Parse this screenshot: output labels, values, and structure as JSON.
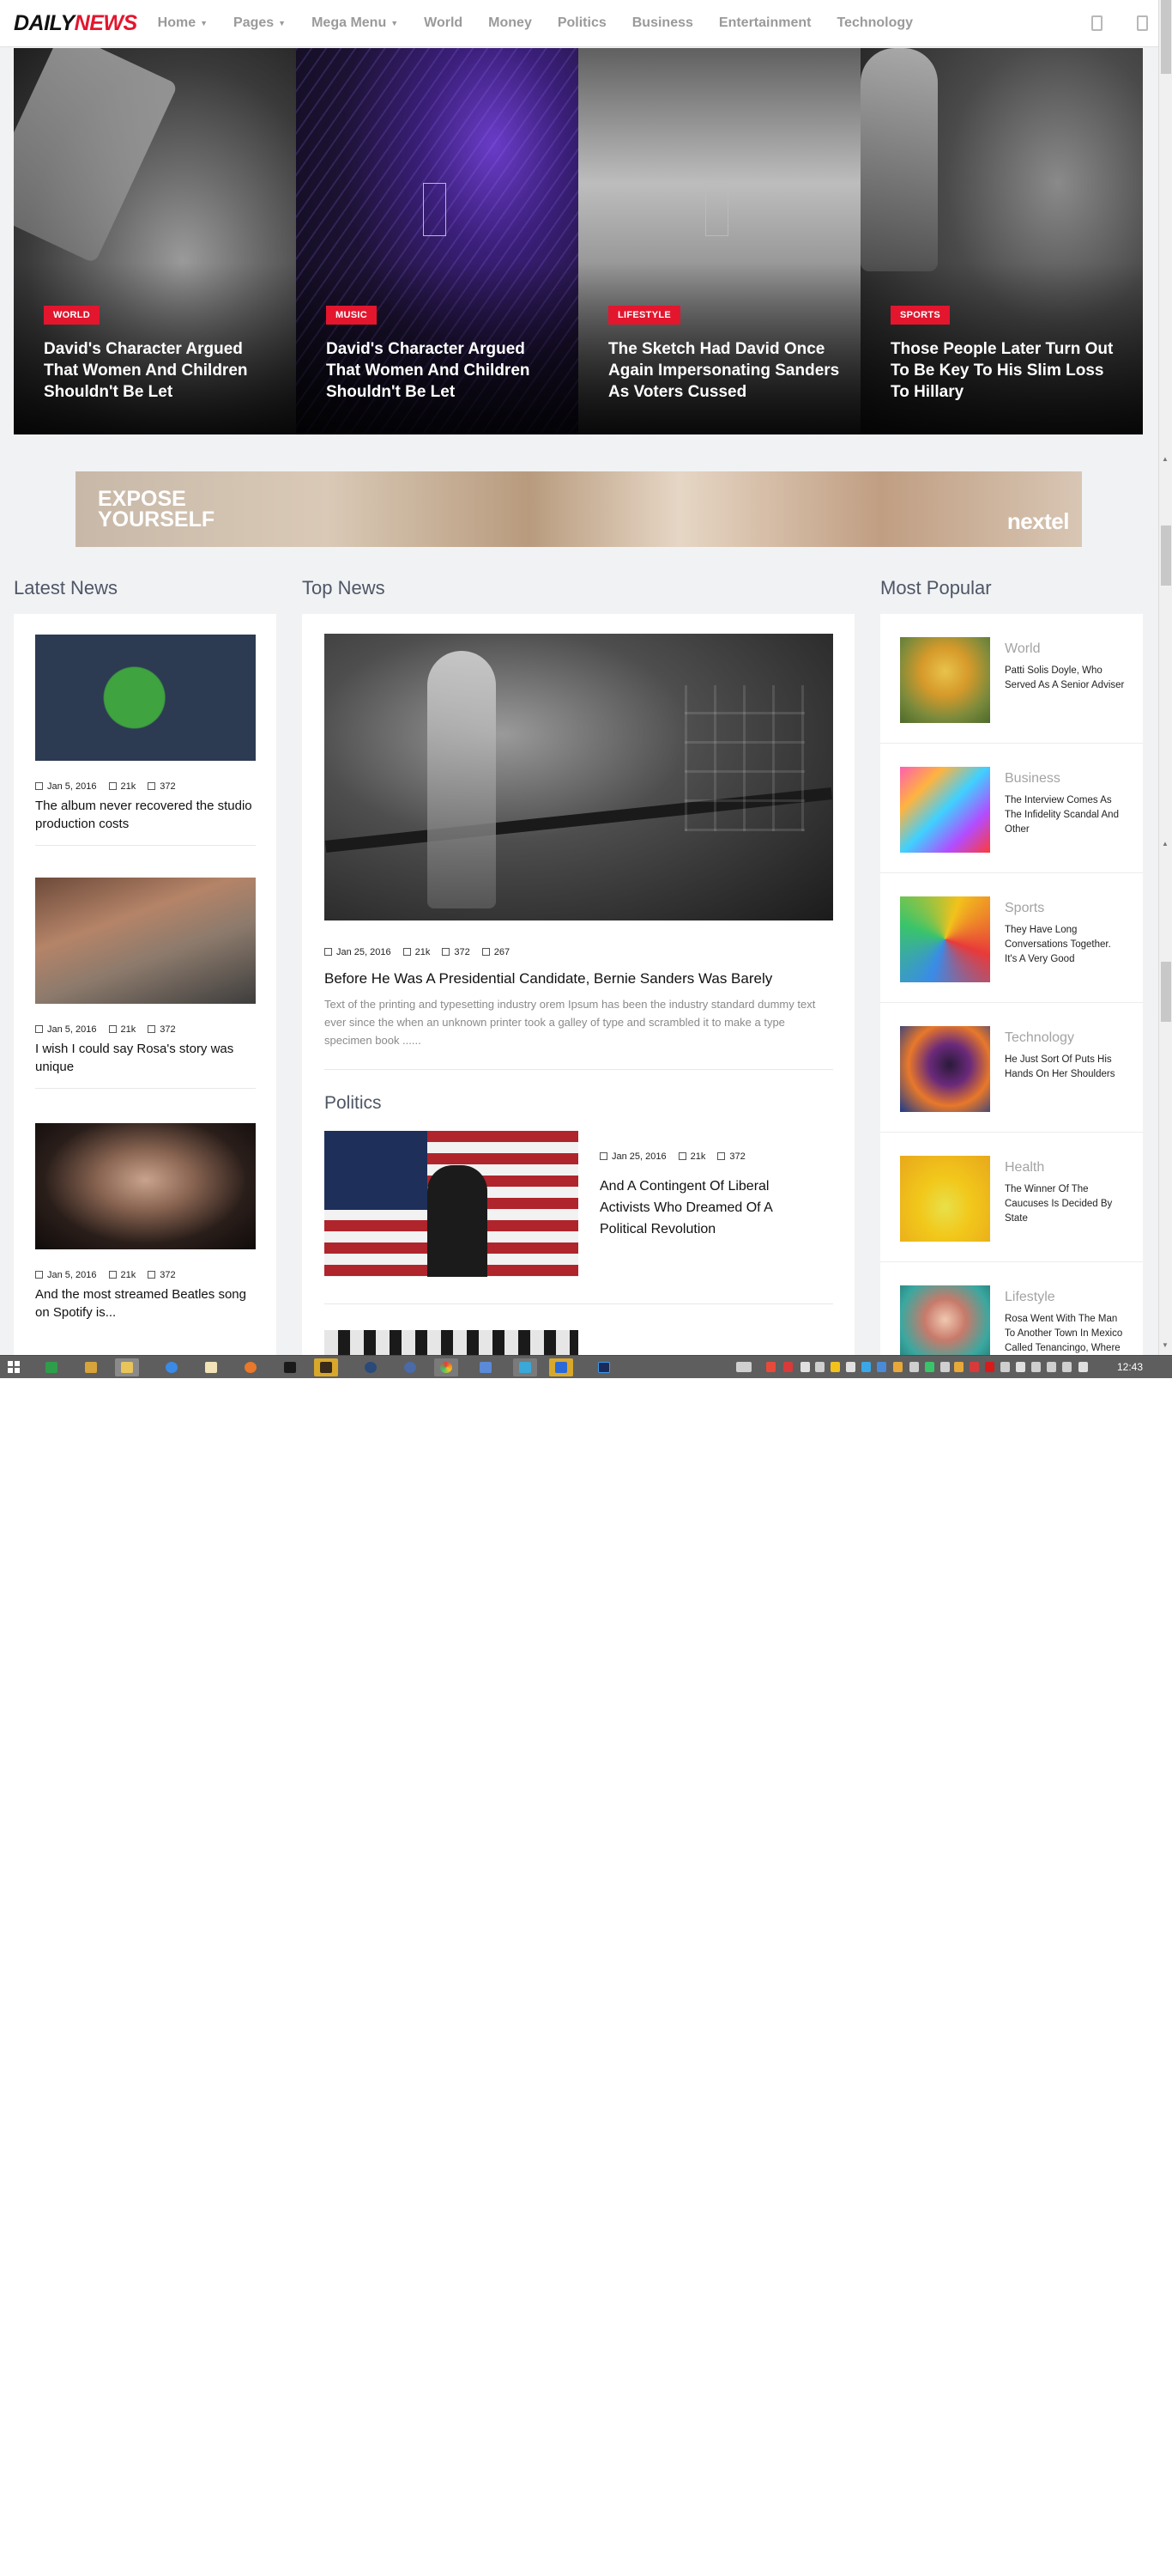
{
  "header": {
    "logo_part1": "DAILY",
    "logo_part2": "NEWS",
    "nav": [
      {
        "label": "Home",
        "dropdown": true
      },
      {
        "label": "Pages",
        "dropdown": true
      },
      {
        "label": "Mega Menu",
        "dropdown": true
      },
      {
        "label": "World",
        "dropdown": false
      },
      {
        "label": "Money",
        "dropdown": false
      },
      {
        "label": "Politics",
        "dropdown": false
      },
      {
        "label": "Business",
        "dropdown": false
      },
      {
        "label": "Entertainment",
        "dropdown": false
      },
      {
        "label": "Technology",
        "dropdown": false
      }
    ],
    "icons": [
      "search-icon",
      "user-icon"
    ]
  },
  "hero": {
    "slides": [
      {
        "category": "WORLD",
        "title": "David's Character Argued That Women And Children Shouldn't Be Let",
        "image": "paintbrush-photo"
      },
      {
        "category": "MUSIC",
        "title": "David's Character Argued That Women And Children Shouldn't Be Let",
        "image": "purple-circuit-photo"
      },
      {
        "category": "LIFESTYLE",
        "title": "The Sketch Had David Once Again Impersonating Sanders As Voters Cussed",
        "image": "gray-gradient-photo"
      },
      {
        "category": "SPORTS",
        "title": "Those People Later Turn Out To Be Key To His Slim Loss To Hillary",
        "image": "boxer-photo"
      }
    ]
  },
  "banner": {
    "line1": "EXPOSE",
    "line2": "YOURSELF",
    "brand": "nextel"
  },
  "latest_news": {
    "heading": "Latest News",
    "items": [
      {
        "date": "Jan 5, 2016",
        "views": "21k",
        "comments": "372",
        "title": "The album never recovered the studio production costs",
        "image": "umbrella-girl-photo"
      },
      {
        "date": "Jan 5, 2016",
        "views": "21k",
        "comments": "372",
        "title": "I wish I could say Rosa's story was unique",
        "image": "girl-ground-photo"
      },
      {
        "date": "Jan 5, 2016",
        "views": "21k",
        "comments": "372",
        "title": "And the most streamed Beatles song on Spotify is...",
        "image": "woman-portrait-photo"
      }
    ]
  },
  "top_news": {
    "heading": "Top News",
    "main": {
      "date": "Jan 25, 2016",
      "views": "21k",
      "comments": "372",
      "likes": "267",
      "title": "Before He Was A Presidential Candidate, Bernie Sanders Was Barely",
      "excerpt": "Text of the printing and typesetting industry orem Ipsum has been the industry standard dummy text ever since the when an unknown printer took a galley of type and scrambled it to make a type specimen book ......"
    },
    "politics": {
      "heading": "Politics",
      "item": {
        "date": "Jan 25, 2016",
        "views": "21k",
        "comments": "372",
        "title": "And A Contingent Of Liberal Activists Who Dreamed Of A Political Revolution"
      }
    }
  },
  "most_popular": {
    "heading": "Most Popular",
    "items": [
      {
        "category": "World",
        "title": "Patti Solis Doyle, Who Served As A Senior Adviser"
      },
      {
        "category": "Business",
        "title": "The Interview Comes As The Infidelity Scandal And Other"
      },
      {
        "category": "Sports",
        "title": "They Have Long Conversations Together. It's A Very Good"
      },
      {
        "category": "Technology",
        "title": "He Just Sort Of Puts His Hands On Her Shoulders"
      },
      {
        "category": "Health",
        "title": "The Winner Of The Caucuses Is Decided By State"
      },
      {
        "category": "Lifestyle",
        "title": "Rosa Went With The Man To Another Town In Mexico Called Tenancingo, Where"
      }
    ]
  },
  "taskbar": {
    "clock": "12:43"
  }
}
